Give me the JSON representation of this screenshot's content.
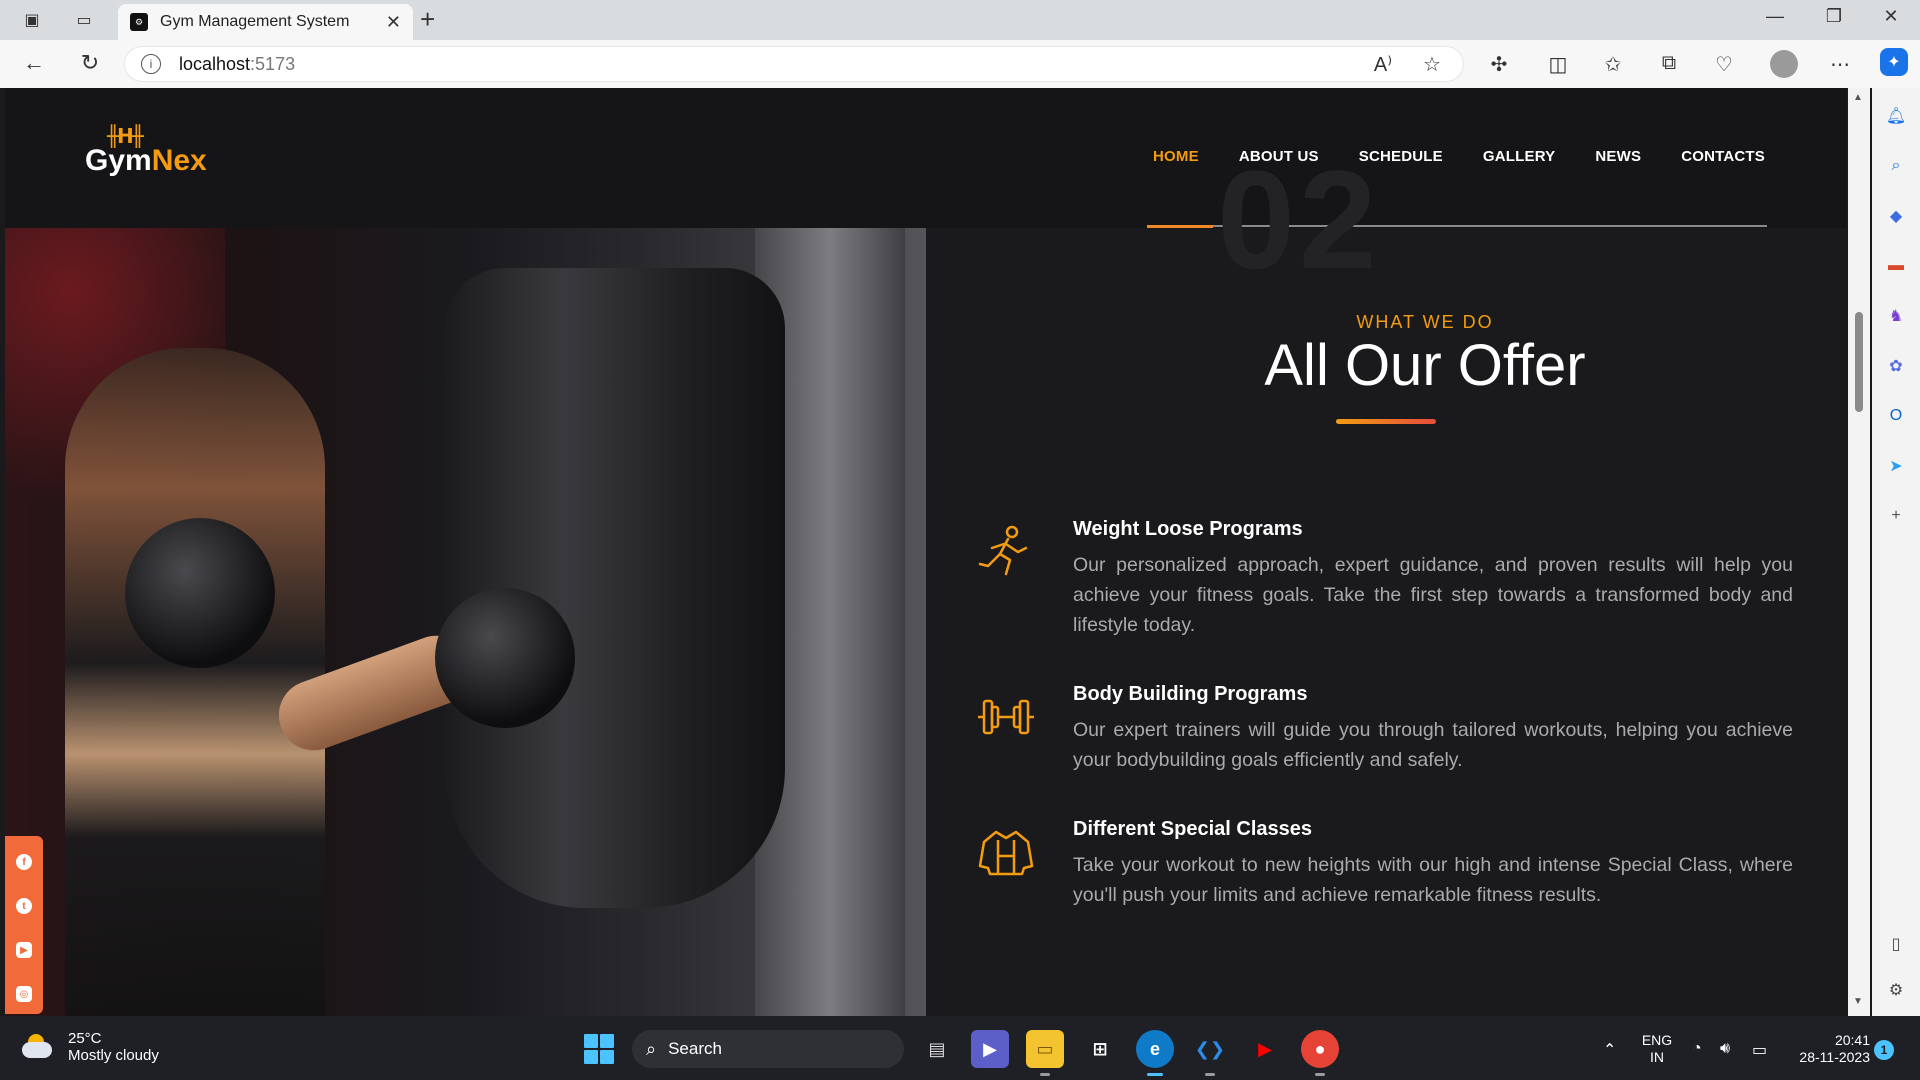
{
  "browser": {
    "tab_title": "Gym Management System",
    "url_host": "localhost",
    "url_port": ":5173"
  },
  "site": {
    "logo_part1": "Gym",
    "logo_part2": "Nex",
    "nav": [
      "HOME",
      "ABOUT US",
      "SCHEDULE",
      "GALLERY",
      "NEWS",
      "CONTACTS"
    ],
    "active_nav": "HOME"
  },
  "offer": {
    "big_number": "02",
    "subtitle": "WHAT WE DO",
    "title": "All Our Offer",
    "programs": [
      {
        "icon": "running-person-icon",
        "title": "Weight Loose Programs",
        "text": "Our personalized approach, expert guidance, and proven results will help you achieve your fitness goals. Take the first step towards a transformed body and lifestyle today."
      },
      {
        "icon": "dumbbell-icon",
        "title": "Body Building Programs",
        "text": "Our expert trainers will guide you through tailored workouts, helping you achieve your bodybuilding goals efficiently and safely."
      },
      {
        "icon": "jacket-icon",
        "title": "Different Special Classes",
        "text": "Take your workout to new heights with our high and intense Special Class, where you'll push your limits and achieve remarkable fitness results."
      }
    ]
  },
  "social": [
    "facebook-icon",
    "twitter-icon",
    "youtube-icon",
    "instagram-icon"
  ],
  "taskbar": {
    "temperature": "25°C",
    "weather": "Mostly cloudy",
    "search_label": "Search",
    "lang_line1": "ENG",
    "lang_line2": "IN",
    "time": "20:41",
    "date": "28-11-2023",
    "notification_count": "1"
  },
  "colors": {
    "accent": "#f39c12",
    "accent_red": "#e74c3c",
    "page_bg": "#1a1a1d"
  }
}
